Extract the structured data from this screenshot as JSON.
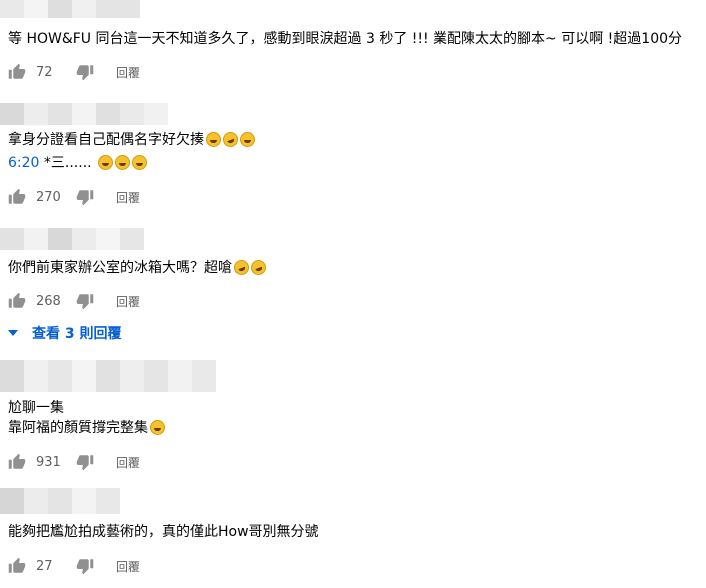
{
  "colors": {
    "accent": "#065fd4",
    "meta": "#606060",
    "text": "#030303"
  },
  "comments": [
    {
      "lines": [
        "等 HOW&FU 同台這一天不知道多久了，感動到眼淚超過 3 秒了 !!!  業配陳太太的腳本~ 可以啊 !超過100分"
      ],
      "likes": "72",
      "reply": "回覆"
    },
    {
      "line1": "拿身分證看自己配偶名字好欠揍",
      "line2_ts": "6:20",
      "line2_rest": " *三......",
      "likes": "270",
      "reply": "回覆"
    },
    {
      "line1": "你們前東家辦公室的冰箱大嗎？超嗆",
      "likes": "268",
      "reply": "回覆",
      "view_replies": "查看 3 則回覆"
    },
    {
      "line1": "尬聊一集",
      "line2": "靠阿福的顏質撐完整集",
      "likes": "931",
      "reply": "回覆"
    },
    {
      "line1": "能夠把尷尬拍成藝術的，真的僅此How哥別無分號",
      "likes": "27",
      "reply": "回覆"
    }
  ],
  "icons": {
    "like": "thumbs-up-icon",
    "dislike": "thumbs-down-icon",
    "expand": "chevron-down-icon",
    "emoji_grin": "grinning-face-icon",
    "emoji_rofl": "rolling-laughing-icon"
  }
}
